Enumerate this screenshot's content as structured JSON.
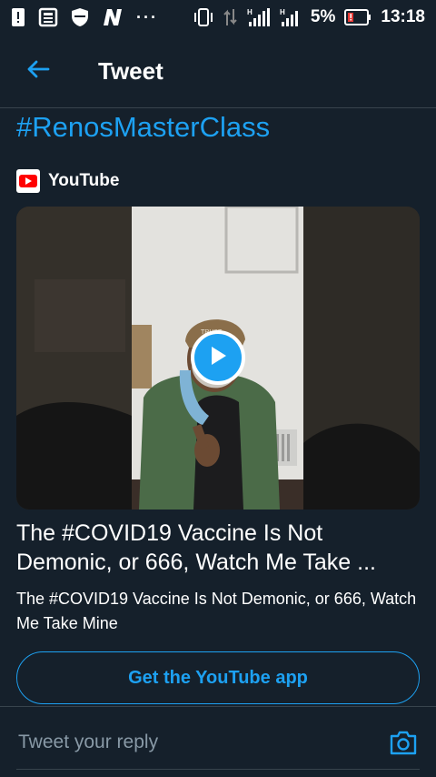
{
  "status_bar": {
    "battery_percent": "5%",
    "time": "13:18",
    "dots": "···",
    "icons": [
      "alert-icon",
      "news-icon",
      "shield-icon",
      "n-app-icon",
      "vibrate-icon",
      "data-arrows-icon",
      "signal-icon",
      "signal-icon",
      "battery-low-icon"
    ]
  },
  "header": {
    "title": "Tweet",
    "back_icon": "arrow-left-icon"
  },
  "tweet": {
    "hashtag": "#RenosMasterClass",
    "card": {
      "source": "YouTube",
      "title": "The #COVID19 Vaccine Is Not Demonic, or 666, Watch Me Take ...",
      "description": "The #COVID19 Vaccine Is Not Demonic, or 666, Watch Me Take Mine",
      "cta": "Get the YouTube app"
    }
  },
  "reply": {
    "placeholder": "Tweet your reply",
    "camera_icon": "camera-icon"
  },
  "colors": {
    "background": "#15202b",
    "accent": "#1da1f2",
    "divider": "#38444d",
    "muted": "#8899a6"
  }
}
